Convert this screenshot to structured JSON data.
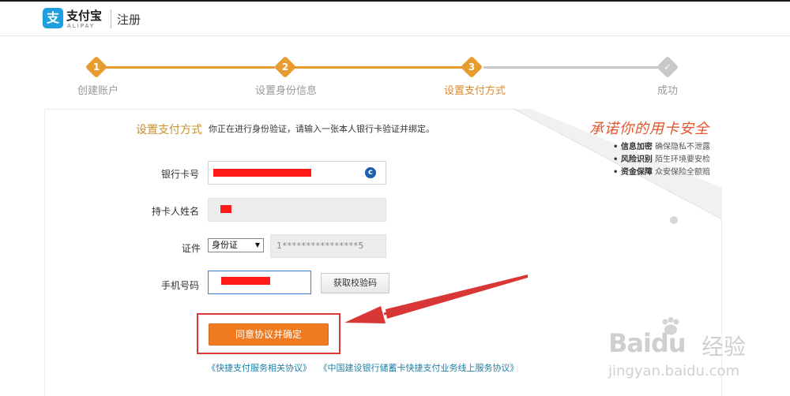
{
  "header": {
    "logo_mark": "支",
    "logo_cn": "支付宝",
    "logo_en": "ALIPAY",
    "title": "注册"
  },
  "steps": [
    {
      "num": "1",
      "label": "创建账户",
      "state": "done"
    },
    {
      "num": "2",
      "label": "设置身份信息",
      "state": "done"
    },
    {
      "num": "3",
      "label": "设置支付方式",
      "state": "active"
    },
    {
      "num": "✓",
      "label": "成功",
      "state": "pending"
    }
  ],
  "promo": {
    "title": "承诺你的用卡安全",
    "items": [
      {
        "bold": "• 信息加密",
        "text": "确保隐私不泄露"
      },
      {
        "bold": "• 风险识别",
        "text": "陌生环境要安检"
      },
      {
        "bold": "• 资金保障",
        "text": "众安保险全额赔"
      }
    ]
  },
  "section": {
    "title": "设置支付方式",
    "desc": "你正在进行身份验证，请输入一张本人银行卡验证并绑定。"
  },
  "form": {
    "card_label": "银行卡号",
    "holder_label": "持卡人姓名",
    "id_label": "证件",
    "id_type": "身份证",
    "id_value": "1****************5",
    "phone_label": "手机号码",
    "sms_button": "获取校验码",
    "submit": "同意协议并确定"
  },
  "links": {
    "link1": "《快捷支付服务相关协议》",
    "link2": "《中国建设银行储蓄卡快捷支付业务线上服务协议》"
  },
  "watermark": {
    "brand": "Baidu",
    "brand_cn": "经验",
    "url": "jingyan.baidu.com"
  },
  "colors": {
    "accent_orange": "#f07a1f",
    "step_done": "#e89b2f",
    "step_pending": "#c8c8c8",
    "alipay_blue": "#1e9fe0",
    "annotation_red": "#d93636"
  }
}
